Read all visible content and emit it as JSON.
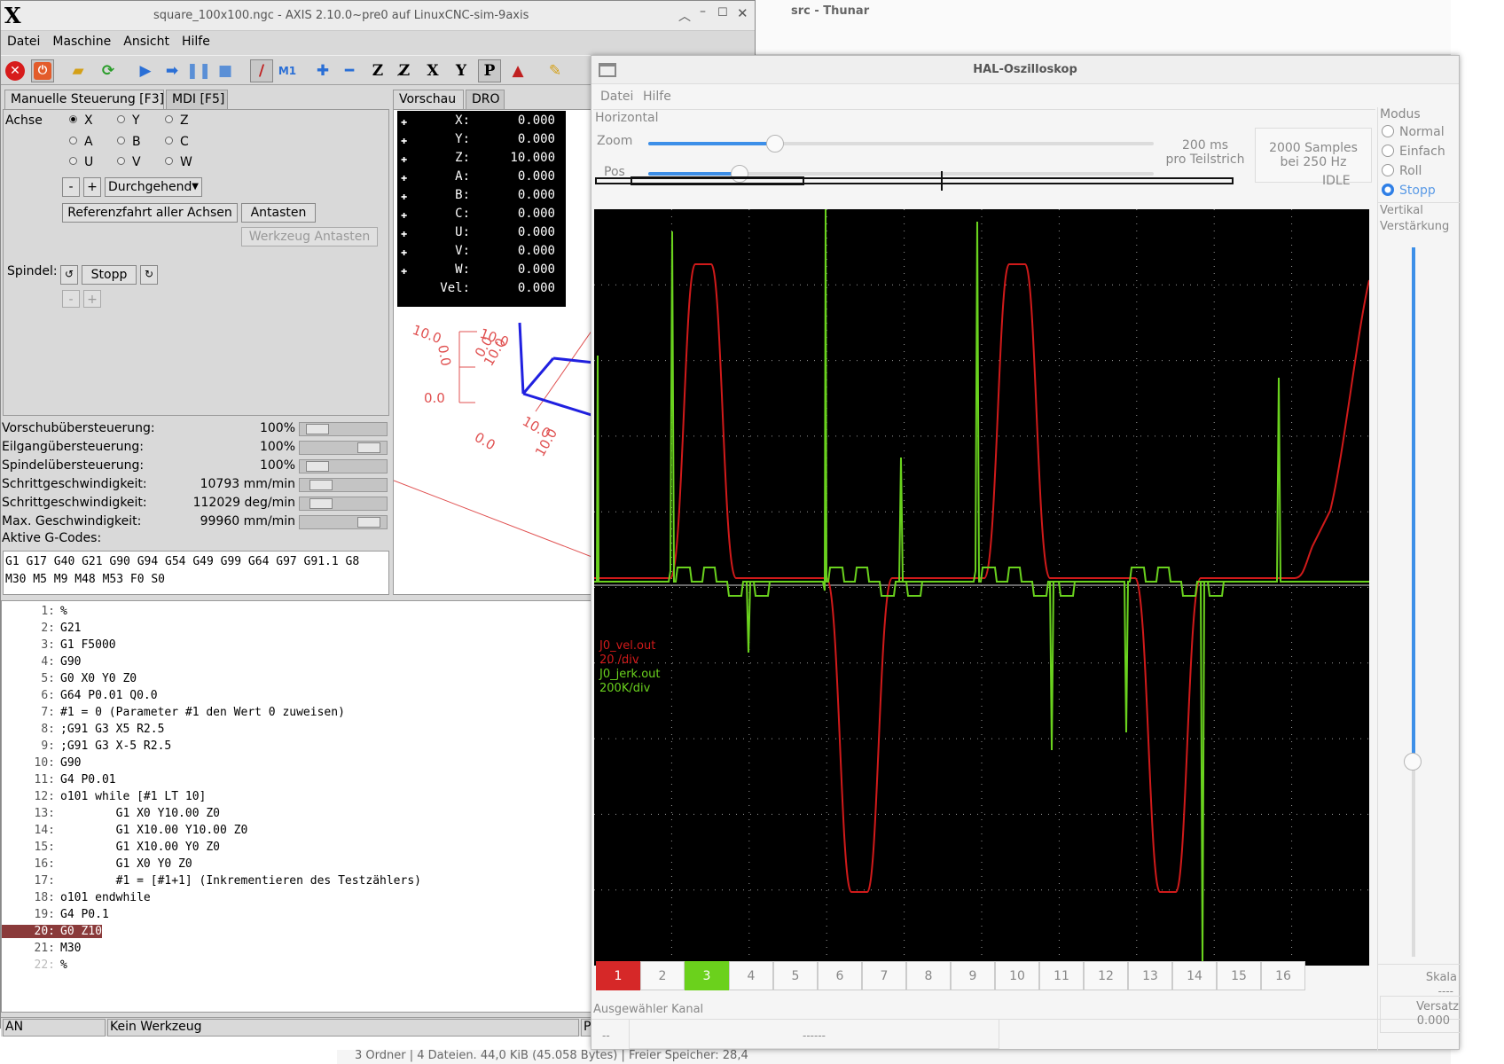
{
  "axis": {
    "title": "square_100x100.ngc - AXIS 2.10.0~pre0 auf LinuxCNC-sim-9axis",
    "menu": [
      "Datei",
      "Maschine",
      "Ansicht",
      "Hilfe"
    ],
    "toolbar_icons": [
      "estop-icon",
      "power-icon",
      "open-file-icon",
      "reload-icon",
      "run-icon",
      "step-icon",
      "pause-icon",
      "stop-icon",
      "block-delete-icon",
      "optional-stop-icon",
      "zoom-in-icon",
      "zoom-out-icon",
      "view-z-icon",
      "view-z2-icon",
      "view-x-icon",
      "view-y-icon",
      "view-p-icon",
      "rotate-icon",
      "clear-plot-icon"
    ],
    "tabs_left": [
      "Manuelle Steuerung [F3]",
      "MDI [F5]"
    ],
    "tabs_right": [
      "Vorschau",
      "DRO"
    ],
    "axis_label": "Achse",
    "axis_radios": [
      {
        "label": "X",
        "checked": true
      },
      {
        "label": "Y",
        "checked": false
      },
      {
        "label": "Z",
        "checked": false
      },
      {
        "label": "A",
        "checked": false
      },
      {
        "label": "B",
        "checked": false
      },
      {
        "label": "C",
        "checked": false
      },
      {
        "label": "U",
        "checked": false
      },
      {
        "label": "V",
        "checked": false
      },
      {
        "label": "W",
        "checked": false
      }
    ],
    "jog_minus": "-",
    "jog_plus": "+",
    "jog_mode": "Durchgehend",
    "home_all": "Referenzfahrt aller Achsen",
    "touch_off": "Antasten",
    "tool_touch_off": "Werkzeug Antasten",
    "spindle_label": "Spindel:",
    "spindle_stop": "Stopp",
    "spindle_minus": "-",
    "spindle_plus": "+",
    "overrides": [
      {
        "label": "Vorschubübersteuerung:",
        "value": "100%",
        "level": 0.1
      },
      {
        "label": "Eilgangübersteuerung:",
        "value": "100%",
        "level": 0.9
      },
      {
        "label": "Spindelübersteuerung:",
        "value": "100%",
        "level": 0.1
      },
      {
        "label": "Schrittgeschwindigkeit:",
        "value": "10793 mm/min",
        "level": 0.15
      },
      {
        "label": "Schrittgeschwindigkeit:",
        "value": "112029 deg/min",
        "level": 0.15
      },
      {
        "label": "Max. Geschwindigkeit:",
        "value": "99960 mm/min",
        "level": 0.9
      }
    ],
    "active_gcodes_label": "Aktive G-Codes:",
    "active_gcodes_line1": "G1 G17 G40 G21 G90 G94 G54 G49 G99 G64 G97 G91.1 G8",
    "active_gcodes_line2": "M30 M5 M9 M48 M53 F0 S0",
    "dro": [
      {
        "axis": "X:",
        "value": "0.000"
      },
      {
        "axis": "Y:",
        "value": "0.000"
      },
      {
        "axis": "Z:",
        "value": "10.000"
      },
      {
        "axis": "A:",
        "value": "0.000"
      },
      {
        "axis": "B:",
        "value": "0.000"
      },
      {
        "axis": "C:",
        "value": "0.000"
      },
      {
        "axis": "U:",
        "value": "0.000"
      },
      {
        "axis": "V:",
        "value": "0.000"
      },
      {
        "axis": "W:",
        "value": "0.000"
      }
    ],
    "dro_vel_label": "Vel:",
    "dro_vel_value": "0.000",
    "preview_labels": {
      "a": "10.0",
      "b": "0.0",
      "c": "10.0",
      "d": "0.0",
      "e": "10.0",
      "f": "0.0",
      "g": "10.0",
      "h": "0.0",
      "i": "10.0"
    },
    "code": [
      {
        "n": "1:",
        "t": "%"
      },
      {
        "n": "2:",
        "t": "G21"
      },
      {
        "n": "3:",
        "t": "G1 F5000"
      },
      {
        "n": "4:",
        "t": "G90"
      },
      {
        "n": "5:",
        "t": "G0 X0 Y0 Z0"
      },
      {
        "n": "6:",
        "t": "G64 P0.01 Q0.0"
      },
      {
        "n": "7:",
        "t": "#1 = 0 (Parameter #1 den Wert 0 zuweisen)"
      },
      {
        "n": "8:",
        "t": ";G91 G3 X5 R2.5"
      },
      {
        "n": "9:",
        "t": ";G91 G3 X-5 R2.5"
      },
      {
        "n": "10:",
        "t": "G90"
      },
      {
        "n": "11:",
        "t": "G4 P0.01"
      },
      {
        "n": "12:",
        "t": "o101 while [#1 LT 10]"
      },
      {
        "n": "13:",
        "t": "        G1 X0 Y10.00 Z0"
      },
      {
        "n": "14:",
        "t": "        G1 X10.00 Y10.00 Z0"
      },
      {
        "n": "15:",
        "t": "        G1 X10.00 Y0 Z0"
      },
      {
        "n": "16:",
        "t": "        G1 X0 Y0 Z0"
      },
      {
        "n": "17:",
        "t": "        #1 = [#1+1] (Inkrementieren des Testzählers)"
      },
      {
        "n": "18:",
        "t": "o101 endwhile"
      },
      {
        "n": "19:",
        "t": "G4 P0.1"
      },
      {
        "n": "20:",
        "t": "G0 Z10"
      },
      {
        "n": "21:",
        "t": "M30"
      },
      {
        "n": "22:",
        "t": "%"
      }
    ],
    "status_left": "AN",
    "status_tool": "Kein Werkzeug",
    "status_right": "Po"
  },
  "thunar": {
    "title": "src - Thunar",
    "status": "3 Ordner  |  4 Dateien. 44,0 KiB (45.058 Bytes)  |  Freier Speicher: 28,4"
  },
  "scope": {
    "title": "HAL-Oszilloskop",
    "menu": [
      "Datei",
      "Hilfe"
    ],
    "horizontal_label": "Horizontal",
    "zoom_label": "Zoom",
    "zoom_level": 0.25,
    "pos_label": "Pos",
    "pos_level": 0.18,
    "timebase_line1": "200 ms",
    "timebase_line2": "pro Teilstrich",
    "samples_line1": "2000 Samples",
    "samples_line2": "bei 250 Hz",
    "state": "IDLE",
    "modus_label": "Modus",
    "modes": [
      {
        "label": "Normal",
        "checked": false
      },
      {
        "label": "Einfach",
        "checked": false
      },
      {
        "label": "Roll",
        "checked": false
      },
      {
        "label": "Stopp",
        "checked": true
      }
    ],
    "vertical_label": "Vertikal",
    "gain_label": "Verstärkung",
    "scale_label": "Skala",
    "scale_value": "----",
    "offset_label": "Versatz",
    "offset_value": "0.000",
    "ch_labels": [
      {
        "name": "J0_vel.out",
        "scale": "20 /div",
        "color": "#d01a1a"
      },
      {
        "name": "J0_jerk.out",
        "scale": "200K/div",
        "color": "#6ad21e"
      }
    ],
    "channels": [
      "1",
      "2",
      "3",
      "4",
      "5",
      "6",
      "7",
      "8",
      "9",
      "10",
      "11",
      "12",
      "13",
      "14",
      "15",
      "16"
    ],
    "active_channels": {
      "1": "#d62828",
      "3": "#6bd11c"
    },
    "selected_channel_label": "Ausgewähler Kanal",
    "selected_channel_short": "--",
    "selected_channel_value": "------",
    "colors": {
      "vel": "#d01a1a",
      "jerk": "#6ad21e",
      "accent": "#3d8fe8"
    }
  }
}
